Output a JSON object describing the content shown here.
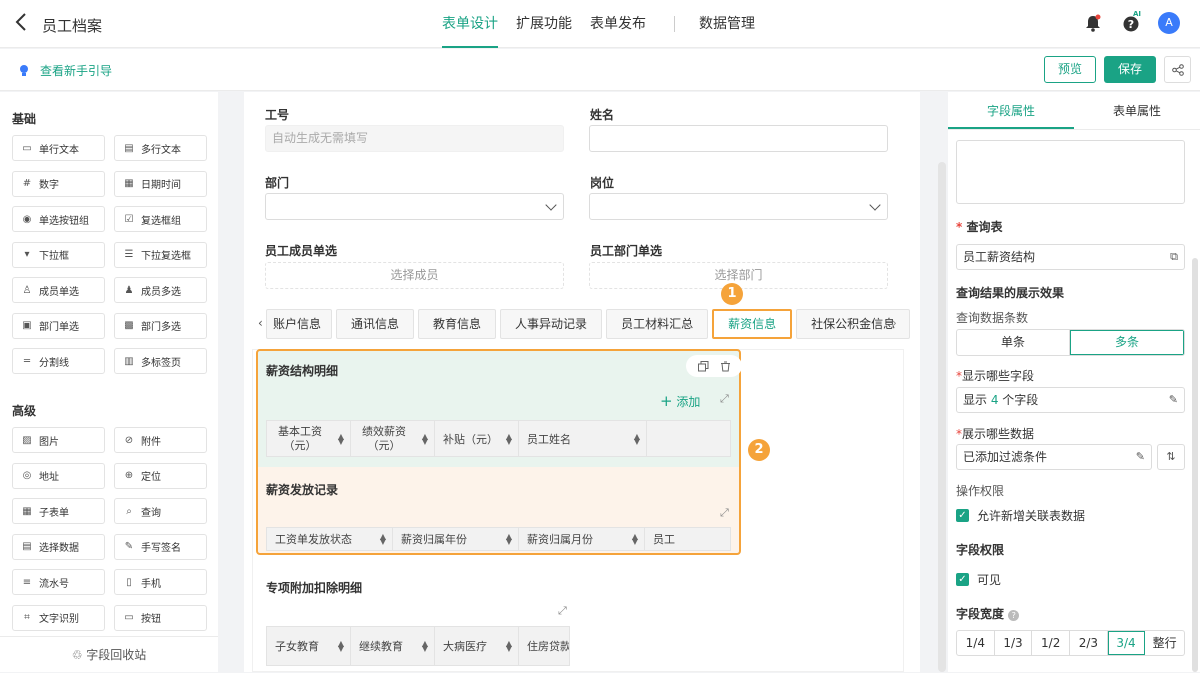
{
  "header": {
    "title": "员工档案",
    "nav": [
      "表单设计",
      "扩展功能",
      "表单发布",
      "数据管理"
    ],
    "active_nav": "表单设计",
    "ai_badge": "AI",
    "avatar": "A"
  },
  "subbar": {
    "guide": "查看新手引导",
    "preview": "预览",
    "save": "保存"
  },
  "palette": {
    "basic_title": "基础",
    "basic": [
      {
        "label": "单行文本",
        "icon": "single-line-text-icon"
      },
      {
        "label": "多行文本",
        "icon": "multi-line-text-icon"
      },
      {
        "label": "数字",
        "icon": "number-icon"
      },
      {
        "label": "日期时间",
        "icon": "calendar-icon"
      },
      {
        "label": "单选按钮组",
        "icon": "radio-icon"
      },
      {
        "label": "复选框组",
        "icon": "checkbox-group-icon"
      },
      {
        "label": "下拉框",
        "icon": "dropdown-icon"
      },
      {
        "label": "下拉复选框",
        "icon": "multi-dropdown-icon"
      },
      {
        "label": "成员单选",
        "icon": "member-icon"
      },
      {
        "label": "成员多选",
        "icon": "members-icon"
      },
      {
        "label": "部门单选",
        "icon": "department-icon"
      },
      {
        "label": "部门多选",
        "icon": "departments-icon"
      },
      {
        "label": "分割线",
        "icon": "divider-icon"
      },
      {
        "label": "多标签页",
        "icon": "tabs-icon"
      }
    ],
    "advanced_title": "高级",
    "advanced": [
      {
        "label": "图片",
        "icon": "image-icon"
      },
      {
        "label": "附件",
        "icon": "attachment-icon"
      },
      {
        "label": "地址",
        "icon": "address-icon"
      },
      {
        "label": "定位",
        "icon": "location-icon"
      },
      {
        "label": "子表单",
        "icon": "subform-icon"
      },
      {
        "label": "查询",
        "icon": "query-icon"
      },
      {
        "label": "选择数据",
        "icon": "select-data-icon"
      },
      {
        "label": "手写签名",
        "icon": "signature-icon"
      },
      {
        "label": "流水号",
        "icon": "serial-icon"
      },
      {
        "label": "手机",
        "icon": "phone-icon"
      },
      {
        "label": "文字识别",
        "icon": "ocr-icon"
      },
      {
        "label": "按钮",
        "icon": "button-icon"
      }
    ],
    "recycle": "字段回收站"
  },
  "form": {
    "employee_id_label": "工号",
    "employee_id_placeholder": "自动生成无需填写",
    "name_label": "姓名",
    "department_label": "部门",
    "position_label": "岗位",
    "member_label": "员工成员单选",
    "member_placeholder": "选择成员",
    "dept_single_label": "员工部门单选",
    "dept_single_placeholder": "选择部门",
    "tabs": [
      "账户信息",
      "通讯信息",
      "教育信息",
      "人事异动记录",
      "员工材料汇总",
      "薪资信息",
      "社保公积金信息"
    ],
    "active_tab": "薪资信息",
    "marker1": "1",
    "marker2": "2",
    "salary_structure": {
      "title": "薪资结构明细",
      "add": "添加",
      "columns": [
        "基本工资（元）",
        "绩效薪资（元）",
        "补贴（元）",
        "员工姓名"
      ]
    },
    "salary_payment": {
      "title": "薪资发放记录",
      "columns": [
        "工资单发放状态",
        "薪资归属年份",
        "薪资归属月份",
        "员工"
      ]
    },
    "deductions": {
      "title": "专项附加扣除明细",
      "columns": [
        "子女教育",
        "继续教育",
        "大病医疗",
        "住房贷款"
      ]
    }
  },
  "props": {
    "tabs": [
      "字段属性",
      "表单属性"
    ],
    "query_table_label": "查询表",
    "query_table_value": "员工薪资结构",
    "display_effect_title": "查询结果的展示效果",
    "count_label": "查询数据条数",
    "count_options": [
      "单条",
      "多条"
    ],
    "count_selected": "多条",
    "fields_label": "显示哪些字段",
    "fields_prefix": "显示 ",
    "fields_count": "4",
    "fields_suffix": " 个字段",
    "data_label": "展示哪些数据",
    "data_value": "已添加过滤条件",
    "op_perm_label": "操作权限",
    "op_perm_check": "允许新增关联表数据",
    "field_perm_label": "字段权限",
    "visible_check": "可见",
    "width_label": "字段宽度",
    "width_options": [
      "1/4",
      "1/3",
      "1/2",
      "2/3",
      "3/4",
      "整行"
    ],
    "width_selected": "3/4"
  },
  "colors": {
    "accent": "#1aa385",
    "highlight": "#f5a33a"
  }
}
